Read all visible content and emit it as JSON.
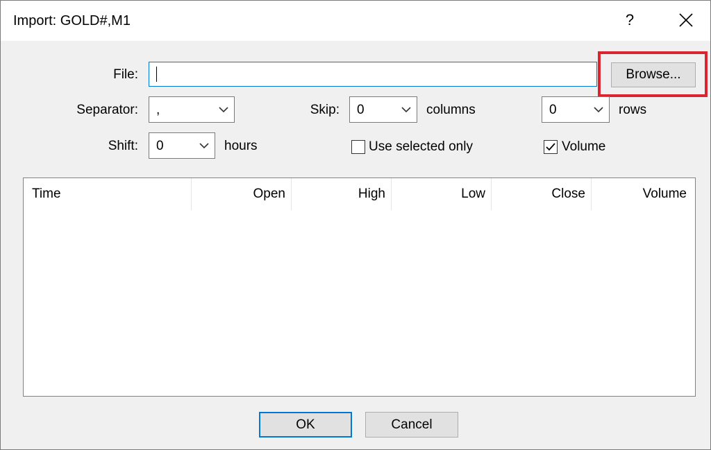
{
  "window": {
    "title": "Import: GOLD#,M1",
    "help_label": "?"
  },
  "file": {
    "label": "File:",
    "value": "",
    "browse_label": "Browse..."
  },
  "separator": {
    "label": "Separator:",
    "value": ","
  },
  "skip": {
    "label": "Skip:",
    "columns_value": "0",
    "columns_label": "columns",
    "rows_value": "0",
    "rows_label": "rows"
  },
  "shift": {
    "label": "Shift:",
    "value": "0",
    "unit_label": "hours"
  },
  "options": {
    "use_selected_label": "Use selected only",
    "use_selected_checked": false,
    "volume_label": "Volume",
    "volume_checked": true
  },
  "table": {
    "columns": [
      "Time",
      "Open",
      "High",
      "Low",
      "Close",
      "Volume"
    ]
  },
  "footer": {
    "ok_label": "OK",
    "cancel_label": "Cancel"
  },
  "colors": {
    "accent": "#0078d7",
    "highlight": "#d9252f"
  }
}
